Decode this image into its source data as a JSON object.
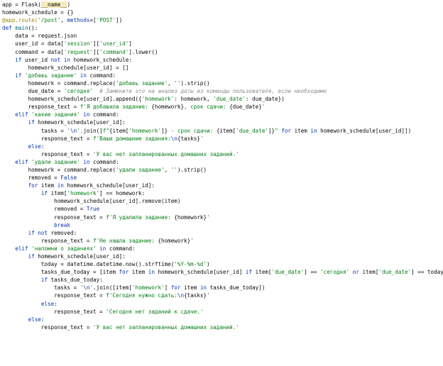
{
  "editor": {
    "colors": {
      "background": "#ffffff",
      "keyword": "#0033b3",
      "string": "#067d17",
      "decorator": "#9e880d",
      "comment": "#8c8c8c",
      "function": "#00627a",
      "escape": "#0037a6"
    },
    "lines": [
      [
        {
          "t": "app = Flask(",
          "c": "sp"
        },
        {
          "t": "__name__",
          "c": "hl"
        },
        {
          "t": ")",
          "c": "sp"
        }
      ],
      [
        {
          "t": "homework_schedule = {}",
          "c": "sp"
        }
      ],
      [
        {
          "t": "@app.route(",
          "c": "dec"
        },
        {
          "t": "'/post'",
          "c": "str"
        },
        {
          "t": ", ",
          "c": "sp"
        },
        {
          "t": "methods",
          "c": "esc"
        },
        {
          "t": "=[",
          "c": "sp"
        },
        {
          "t": "'POST'",
          "c": "str"
        },
        {
          "t": "])",
          "c": "sp"
        }
      ],
      [
        {
          "t": "def ",
          "c": "kw"
        },
        {
          "t": "main",
          "c": "fn"
        },
        {
          "t": "():",
          "c": "sp"
        }
      ],
      [
        {
          "t": "    data = request.json",
          "c": "sp"
        }
      ],
      [
        {
          "t": "    user_id = data[",
          "c": "sp"
        },
        {
          "t": "'session'",
          "c": "str"
        },
        {
          "t": "][",
          "c": "sp"
        },
        {
          "t": "'user_id'",
          "c": "str"
        },
        {
          "t": "]",
          "c": "sp"
        }
      ],
      [
        {
          "t": "    command = data[",
          "c": "sp"
        },
        {
          "t": "'request'",
          "c": "str"
        },
        {
          "t": "][",
          "c": "sp"
        },
        {
          "t": "'command'",
          "c": "str"
        },
        {
          "t": "].lower()",
          "c": "sp"
        }
      ],
      [
        {
          "t": "    ",
          "c": "sp"
        },
        {
          "t": "if ",
          "c": "kw"
        },
        {
          "t": "user_id ",
          "c": "sp"
        },
        {
          "t": "not in ",
          "c": "kw"
        },
        {
          "t": "homework_schedule:",
          "c": "sp"
        }
      ],
      [
        {
          "t": "        homework_schedule[user_id] = []",
          "c": "sp"
        }
      ],
      [
        {
          "t": "    ",
          "c": "sp"
        },
        {
          "t": "if ",
          "c": "kw"
        },
        {
          "t": "'добавь задание'",
          "c": "str"
        },
        {
          "t": " in ",
          "c": "kw"
        },
        {
          "t": "command:",
          "c": "sp"
        }
      ],
      [
        {
          "t": "        homework = command.replace(",
          "c": "sp"
        },
        {
          "t": "'добавь задание'",
          "c": "str"
        },
        {
          "t": ", ",
          "c": "sp"
        },
        {
          "t": "''",
          "c": "str"
        },
        {
          "t": ").strip()",
          "c": "sp"
        }
      ],
      [
        {
          "t": "        due_date = ",
          "c": "sp"
        },
        {
          "t": "'сегодня'",
          "c": "str"
        },
        {
          "t": "  # Замените это на анализ даты из команды пользователя, если необходимо",
          "c": "cmt"
        }
      ],
      [
        {
          "t": "        homework_schedule[user_id].append({",
          "c": "sp"
        },
        {
          "t": "'homework'",
          "c": "str"
        },
        {
          "t": ": homework, ",
          "c": "sp"
        },
        {
          "t": "'due_date'",
          "c": "str"
        },
        {
          "t": ": due_date})",
          "c": "sp"
        }
      ],
      [
        {
          "t": "        response_text = ",
          "c": "sp"
        },
        {
          "t": "f'Я добавила задание: ",
          "c": "str"
        },
        {
          "t": "{homework}",
          "c": "sp"
        },
        {
          "t": ", срок сдачи: ",
          "c": "str"
        },
        {
          "t": "{due_date}",
          "c": "sp"
        },
        {
          "t": "'",
          "c": "str"
        }
      ],
      [
        {
          "t": "    ",
          "c": "sp"
        },
        {
          "t": "elif ",
          "c": "kw"
        },
        {
          "t": "'какие задания'",
          "c": "str"
        },
        {
          "t": " in ",
          "c": "kw"
        },
        {
          "t": "command:",
          "c": "sp"
        }
      ],
      [
        {
          "t": "        ",
          "c": "sp"
        },
        {
          "t": "if ",
          "c": "kw"
        },
        {
          "t": "homework_schedule[user_id]:",
          "c": "sp"
        }
      ],
      [
        {
          "t": "            tasks = ",
          "c": "sp"
        },
        {
          "t": "'",
          "c": "str"
        },
        {
          "t": "\\n",
          "c": "esc"
        },
        {
          "t": "'",
          "c": "str"
        },
        {
          "t": ".join([",
          "c": "sp"
        },
        {
          "t": "f\"",
          "c": "str"
        },
        {
          "t": "{item[",
          "c": "sp"
        },
        {
          "t": "'homework'",
          "c": "str"
        },
        {
          "t": "]}",
          "c": "sp"
        },
        {
          "t": " - срок сдачи: ",
          "c": "str"
        },
        {
          "t": "{item[",
          "c": "sp"
        },
        {
          "t": "'due_date'",
          "c": "str"
        },
        {
          "t": "]}",
          "c": "sp"
        },
        {
          "t": "\"",
          "c": "str"
        },
        {
          "t": " for ",
          "c": "kw"
        },
        {
          "t": "item ",
          "c": "sp"
        },
        {
          "t": "in ",
          "c": "kw"
        },
        {
          "t": "homework_schedule[user_id]])",
          "c": "sp"
        }
      ],
      [
        {
          "t": "            response_text = ",
          "c": "sp"
        },
        {
          "t": "f'Ваши домашние задания:",
          "c": "str"
        },
        {
          "t": "\\n",
          "c": "esc"
        },
        {
          "t": "{tasks}",
          "c": "sp"
        },
        {
          "t": "'",
          "c": "str"
        }
      ],
      [
        {
          "t": "        ",
          "c": "sp"
        },
        {
          "t": "else",
          "c": "kw"
        },
        {
          "t": ":",
          "c": "sp"
        }
      ],
      [
        {
          "t": "            response_text = ",
          "c": "sp"
        },
        {
          "t": "'У вас нет запланированных домашних заданий.'",
          "c": "str"
        }
      ],
      [
        {
          "t": "    ",
          "c": "sp"
        },
        {
          "t": "elif ",
          "c": "kw"
        },
        {
          "t": "'удали задание'",
          "c": "str"
        },
        {
          "t": " in ",
          "c": "kw"
        },
        {
          "t": "command:",
          "c": "sp"
        }
      ],
      [
        {
          "t": "        homework = command.replace(",
          "c": "sp"
        },
        {
          "t": "'удали задание'",
          "c": "str"
        },
        {
          "t": ", ",
          "c": "sp"
        },
        {
          "t": "''",
          "c": "str"
        },
        {
          "t": ").strip()",
          "c": "sp"
        }
      ],
      [
        {
          "t": "        removed = ",
          "c": "sp"
        },
        {
          "t": "False",
          "c": "kw"
        }
      ],
      [
        {
          "t": "        ",
          "c": "sp"
        },
        {
          "t": "for ",
          "c": "kw"
        },
        {
          "t": "item ",
          "c": "sp"
        },
        {
          "t": "in ",
          "c": "kw"
        },
        {
          "t": "homework_schedule[user_id]:",
          "c": "sp"
        }
      ],
      [
        {
          "t": "            ",
          "c": "sp"
        },
        {
          "t": "if ",
          "c": "kw"
        },
        {
          "t": "item[",
          "c": "sp"
        },
        {
          "t": "'homework'",
          "c": "str"
        },
        {
          "t": "] == homework:",
          "c": "sp"
        }
      ],
      [
        {
          "t": "                homework_schedule[user_id].remove(item)",
          "c": "sp"
        }
      ],
      [
        {
          "t": "                removed = ",
          "c": "sp"
        },
        {
          "t": "True",
          "c": "kw"
        }
      ],
      [
        {
          "t": "                response_text = ",
          "c": "sp"
        },
        {
          "t": "f'Я удалила задание: ",
          "c": "str"
        },
        {
          "t": "{homework}",
          "c": "sp"
        },
        {
          "t": "'",
          "c": "str"
        }
      ],
      [
        {
          "t": "                ",
          "c": "sp"
        },
        {
          "t": "break",
          "c": "kw"
        }
      ],
      [
        {
          "t": "        ",
          "c": "sp"
        },
        {
          "t": "if not ",
          "c": "kw"
        },
        {
          "t": "removed:",
          "c": "sp"
        }
      ],
      [
        {
          "t": "            response_text = ",
          "c": "sp"
        },
        {
          "t": "f'Не нашла задание: ",
          "c": "str"
        },
        {
          "t": "{homework}",
          "c": "sp"
        },
        {
          "t": "'",
          "c": "str"
        }
      ],
      [
        {
          "t": "    ",
          "c": "sp"
        },
        {
          "t": "elif ",
          "c": "kw"
        },
        {
          "t": "'напомни о заданиях'",
          "c": "str"
        },
        {
          "t": " in ",
          "c": "kw"
        },
        {
          "t": "command:",
          "c": "sp"
        }
      ],
      [
        {
          "t": "        ",
          "c": "sp"
        },
        {
          "t": "if ",
          "c": "kw"
        },
        {
          "t": "homework_schedule[user_id]:",
          "c": "sp"
        }
      ],
      [
        {
          "t": "            today = datetime.datetime.now().strftime(",
          "c": "sp"
        },
        {
          "t": "'%Y-%m-%d'",
          "c": "str"
        },
        {
          "t": ")",
          "c": "sp"
        }
      ],
      [
        {
          "t": "            tasks_due_today = [item ",
          "c": "sp"
        },
        {
          "t": "for ",
          "c": "kw"
        },
        {
          "t": "item ",
          "c": "sp"
        },
        {
          "t": "in ",
          "c": "kw"
        },
        {
          "t": "homework_schedule[user_id] ",
          "c": "sp"
        },
        {
          "t": "if ",
          "c": "kw"
        },
        {
          "t": "item[",
          "c": "sp"
        },
        {
          "t": "'due_date'",
          "c": "str"
        },
        {
          "t": "] == ",
          "c": "sp"
        },
        {
          "t": "'сегодня'",
          "c": "str"
        },
        {
          "t": " or ",
          "c": "kw"
        },
        {
          "t": "item[",
          "c": "sp"
        },
        {
          "t": "'due_date'",
          "c": "str"
        },
        {
          "t": "] == today]",
          "c": "sp"
        }
      ],
      [
        {
          "t": "            ",
          "c": "sp"
        },
        {
          "t": "if ",
          "c": "kw"
        },
        {
          "t": "tasks_due_today:",
          "c": "sp"
        }
      ],
      [
        {
          "t": "                tasks = ",
          "c": "sp"
        },
        {
          "t": "'",
          "c": "str"
        },
        {
          "t": "\\n",
          "c": "esc"
        },
        {
          "t": "'",
          "c": "str"
        },
        {
          "t": ".join([item[",
          "c": "sp"
        },
        {
          "t": "'homework'",
          "c": "str"
        },
        {
          "t": "] ",
          "c": "sp"
        },
        {
          "t": "for ",
          "c": "kw"
        },
        {
          "t": "item ",
          "c": "sp"
        },
        {
          "t": "in ",
          "c": "kw"
        },
        {
          "t": "tasks_due_today])",
          "c": "sp"
        }
      ],
      [
        {
          "t": "                response_text = ",
          "c": "sp"
        },
        {
          "t": "f'Сегодня нужно сдать:",
          "c": "str"
        },
        {
          "t": "\\n",
          "c": "esc"
        },
        {
          "t": "{tasks}",
          "c": "sp"
        },
        {
          "t": "'",
          "c": "str"
        }
      ],
      [
        {
          "t": "            ",
          "c": "sp"
        },
        {
          "t": "else",
          "c": "kw"
        },
        {
          "t": ":",
          "c": "sp"
        }
      ],
      [
        {
          "t": "                response_text = ",
          "c": "sp"
        },
        {
          "t": "'Сегодня нет заданий к сдаче.'",
          "c": "str"
        }
      ],
      [
        {
          "t": "        ",
          "c": "sp"
        },
        {
          "t": "else",
          "c": "kw"
        },
        {
          "t": ":",
          "c": "sp"
        }
      ],
      [
        {
          "t": "            response_text = ",
          "c": "sp"
        },
        {
          "t": "'У вас нет запланированных домашних заданий.'",
          "c": "str"
        }
      ]
    ]
  }
}
